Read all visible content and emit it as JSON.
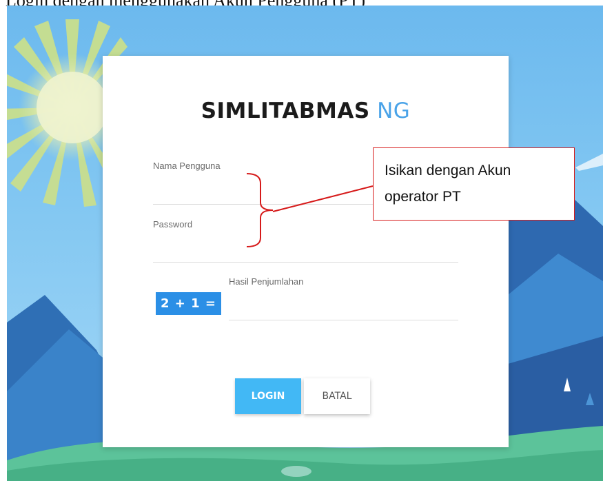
{
  "document": {
    "caption": "Login dengan menggunakan Akun Pengguna (PT)"
  },
  "login": {
    "brand_main": "SIMLITABMAS",
    "brand_suffix": "NG",
    "username_label": "Nama Pengguna",
    "password_label": "Password",
    "captcha_text": "2 + 1 =",
    "sum_label": "Hasil Penjumlahan",
    "login_button": "LOGIN",
    "cancel_button": "BATAL"
  },
  "annotation": {
    "line1": "Isikan dengan Akun",
    "line2": "operator PT"
  },
  "colors": {
    "accent": "#4aa3e8",
    "login_button": "#42b8f5",
    "captcha_bg": "#2b8fe6",
    "annotation_red": "#d61a1a"
  }
}
